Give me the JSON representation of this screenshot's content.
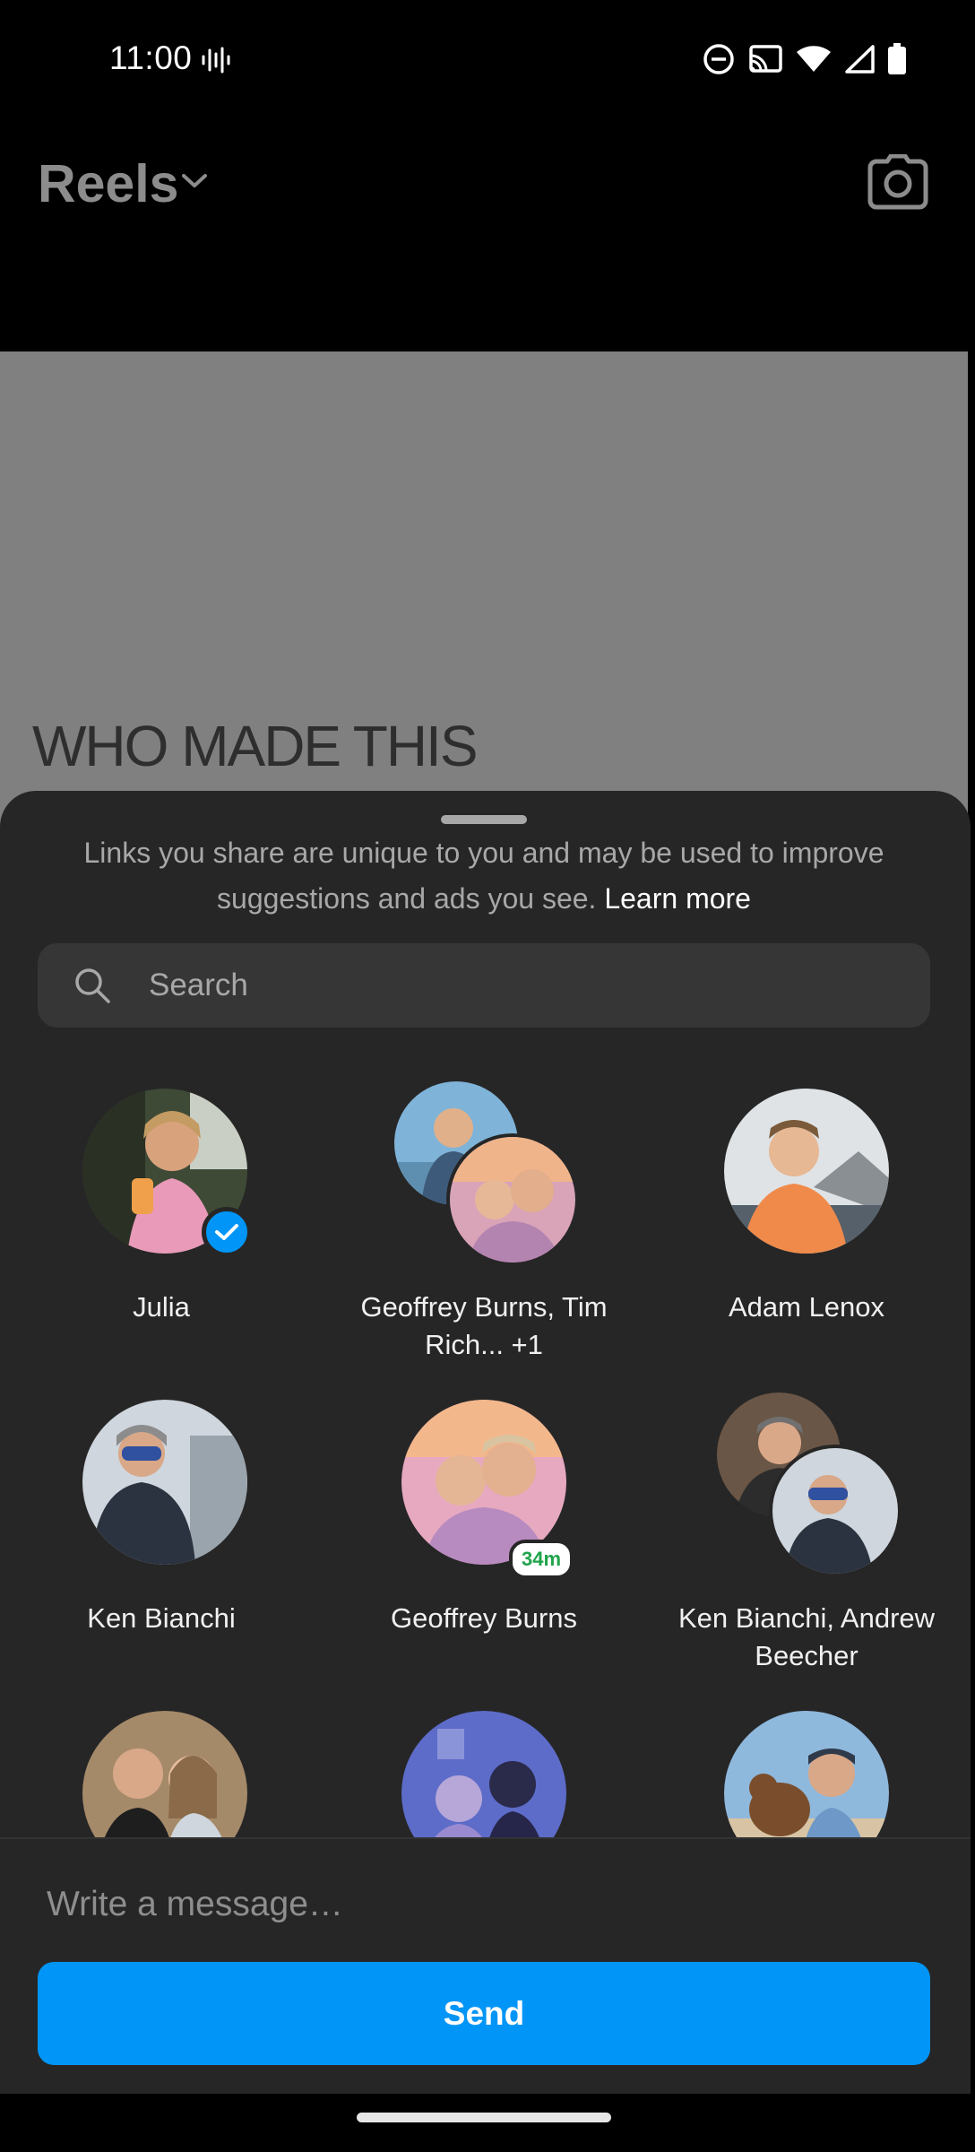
{
  "status_bar": {
    "time": "11:00"
  },
  "header": {
    "title": "Reels"
  },
  "video": {
    "caption": "WHO MADE THIS"
  },
  "share_sheet": {
    "notice": "Links you share are unique to you and may be used to improve suggestions and ads you see.",
    "learn_more": "Learn more",
    "search_placeholder": "Search",
    "contacts": [
      {
        "name": "Julia",
        "selected": true
      },
      {
        "name": "Geoffrey Burns, Tim Rich... +1"
      },
      {
        "name": "Adam Lenox"
      },
      {
        "name": "Ken Bianchi"
      },
      {
        "name": "Geoffrey Burns",
        "badge": "34m"
      },
      {
        "name": "Ken Bianchi, Andrew Beecher"
      },
      {
        "name": ""
      },
      {
        "name": ""
      },
      {
        "name": ""
      }
    ],
    "message_placeholder": "Write a message…",
    "send_label": "Send"
  },
  "colors": {
    "accent": "#0095f6",
    "sheet_bg": "#262626",
    "video_bg": "#808080"
  }
}
